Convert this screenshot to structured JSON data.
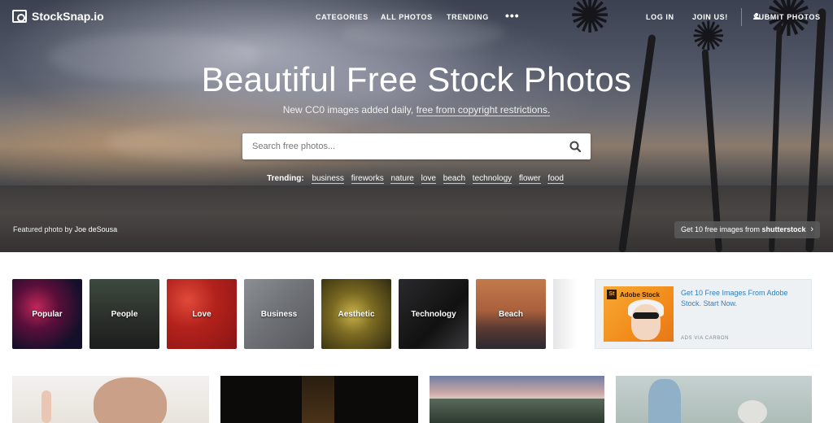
{
  "site": {
    "logo": "StockSnap.io"
  },
  "nav": {
    "categories": "CATEGORIES",
    "all_photos": "ALL PHOTOS",
    "trending": "TRENDING",
    "more": "•••",
    "login": "LOG IN",
    "join": "JOIN US!",
    "submit": "SUBMIT PHOTOS"
  },
  "hero": {
    "title": "Beautiful Free Stock Photos",
    "subtitle_prefix": "New CC0 images added daily, ",
    "subtitle_link": "free from copyright restrictions.",
    "search_placeholder": "Search free photos...",
    "trending_label": "Trending:",
    "trending_tags": [
      "business",
      "fireworks",
      "nature",
      "love",
      "beach",
      "technology",
      "flower",
      "food"
    ],
    "featured_prefix": "Featured photo by ",
    "featured_author": "Joe deSousa",
    "shutter_text": "Get 10 free images from ",
    "shutter_brand": "shutterstock"
  },
  "categories": [
    {
      "label": "Popular"
    },
    {
      "label": "People"
    },
    {
      "label": "Love"
    },
    {
      "label": "Business"
    },
    {
      "label": "Aesthetic"
    },
    {
      "label": "Technology"
    },
    {
      "label": "Beach"
    }
  ],
  "ad": {
    "logo_mark": "St",
    "logo_text": "Adobe Stock",
    "text": "Get 10 Free Images From Adobe Stock. Start Now.",
    "via": "ADS VIA CARBON"
  },
  "colors": {
    "ad_link": "#2d7fc1",
    "hero_text": "#ffffff"
  }
}
